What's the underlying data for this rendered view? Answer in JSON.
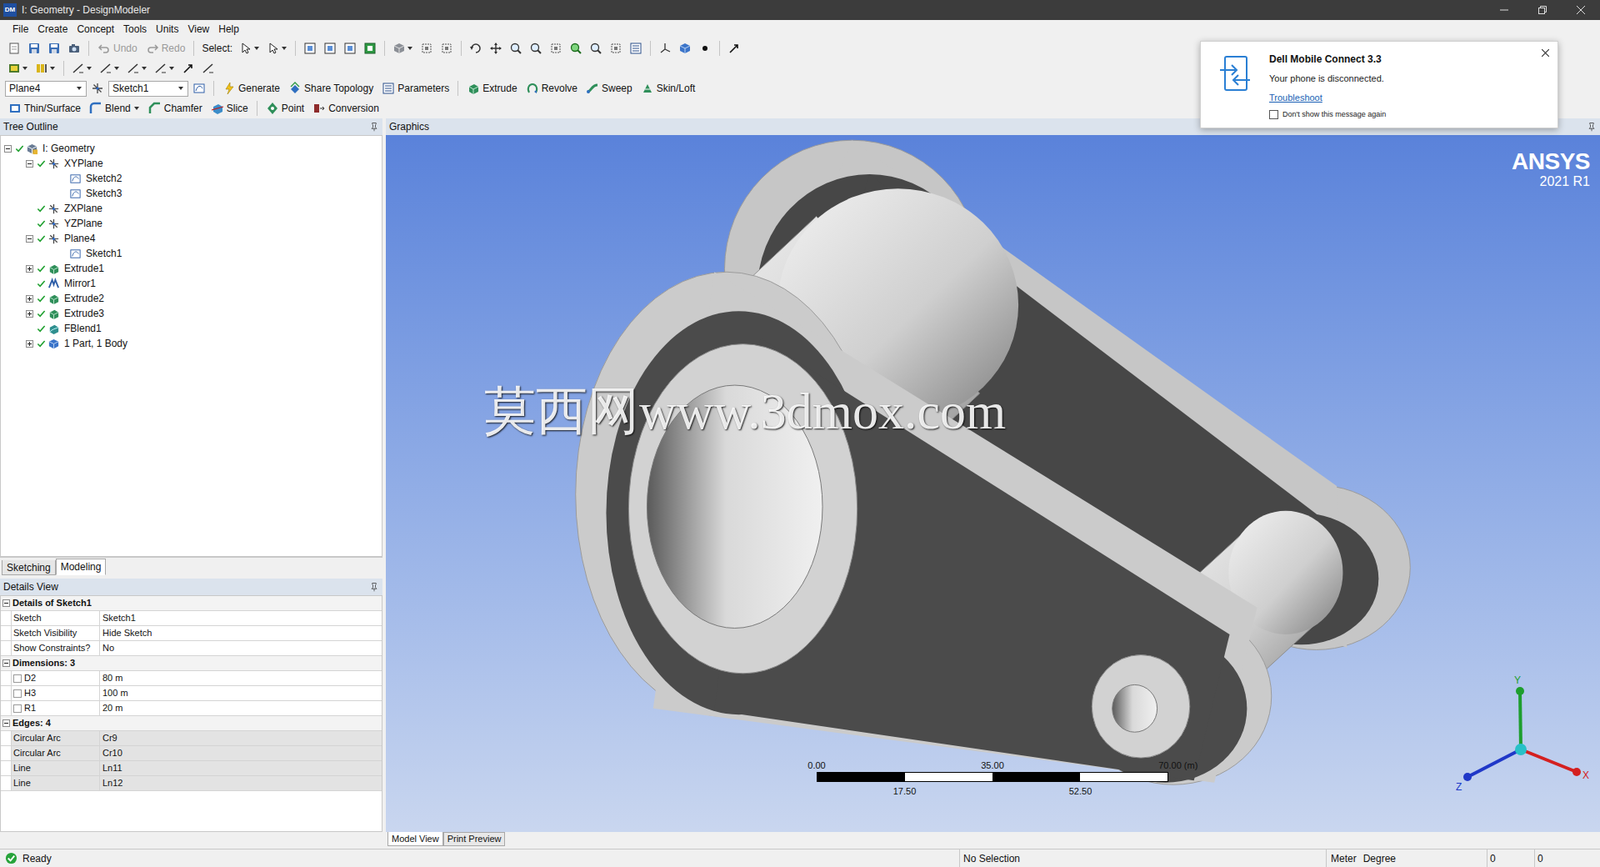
{
  "window": {
    "title": "I: Geometry - DesignModeler",
    "badge": "DM"
  },
  "menu": [
    "File",
    "Create",
    "Concept",
    "Tools",
    "Units",
    "View",
    "Help"
  ],
  "toolbar": {
    "undo": {
      "label": "Undo",
      "disabled": true
    },
    "redo": {
      "label": "Redo",
      "disabled": true
    },
    "select_label": "Select:",
    "plane": "Plane4",
    "sketch": "Sketch1",
    "features": [
      {
        "label": "Generate"
      },
      {
        "label": "Share Topology"
      },
      {
        "label": "Parameters"
      },
      {
        "label": "Extrude"
      },
      {
        "label": "Revolve"
      },
      {
        "label": "Sweep"
      },
      {
        "label": "Skin/Loft"
      }
    ],
    "tools": [
      {
        "label": "Thin/Surface",
        "dropdown": false
      },
      {
        "label": "Blend",
        "dropdown": true
      },
      {
        "label": "Chamfer",
        "dropdown": false
      },
      {
        "label": "Slice",
        "dropdown": false
      },
      {
        "label": "Point",
        "dropdown": false
      },
      {
        "label": "Conversion",
        "dropdown": false
      }
    ]
  },
  "tree": {
    "title": "Tree Outline",
    "items": [
      {
        "label": "I: Geometry",
        "depth": 0,
        "expandable": true,
        "expanded": true,
        "ok": true,
        "kind": "geometry"
      },
      {
        "label": "XYPlane",
        "depth": 1,
        "expandable": true,
        "expanded": true,
        "ok": true,
        "kind": "plane"
      },
      {
        "label": "Sketch2",
        "depth": 2,
        "expandable": false,
        "expanded": false,
        "ok": false,
        "kind": "sketch"
      },
      {
        "label": "Sketch3",
        "depth": 2,
        "expandable": false,
        "expanded": false,
        "ok": false,
        "kind": "sketch"
      },
      {
        "label": "ZXPlane",
        "depth": 1,
        "expandable": false,
        "expanded": false,
        "ok": true,
        "kind": "plane"
      },
      {
        "label": "YZPlane",
        "depth": 1,
        "expandable": false,
        "expanded": false,
        "ok": true,
        "kind": "plane"
      },
      {
        "label": "Plane4",
        "depth": 1,
        "expandable": true,
        "expanded": true,
        "ok": true,
        "kind": "plane"
      },
      {
        "label": "Sketch1",
        "depth": 2,
        "expandable": false,
        "expanded": false,
        "ok": false,
        "kind": "sketch"
      },
      {
        "label": "Extrude1",
        "depth": 1,
        "expandable": true,
        "expanded": false,
        "ok": true,
        "kind": "extrude"
      },
      {
        "label": "Mirror1",
        "depth": 1,
        "expandable": false,
        "expanded": false,
        "ok": true,
        "kind": "mirror"
      },
      {
        "label": "Extrude2",
        "depth": 1,
        "expandable": true,
        "expanded": false,
        "ok": true,
        "kind": "extrude"
      },
      {
        "label": "Extrude3",
        "depth": 1,
        "expandable": true,
        "expanded": false,
        "ok": true,
        "kind": "extrude"
      },
      {
        "label": "FBlend1",
        "depth": 1,
        "expandable": false,
        "expanded": false,
        "ok": true,
        "kind": "blend"
      },
      {
        "label": "1 Part, 1 Body",
        "depth": 1,
        "expandable": true,
        "expanded": false,
        "ok": true,
        "kind": "part"
      }
    ]
  },
  "panel_tabs": [
    {
      "label": "Sketching",
      "selected": false
    },
    {
      "label": "Modeling",
      "selected": true
    }
  ],
  "details": {
    "title": "Details View",
    "groups": [
      {
        "label": "Details of Sketch1",
        "expanded": true,
        "rows": [
          {
            "label": "Sketch",
            "value": "Sketch1",
            "kind": "plain",
            "greyed": false
          },
          {
            "label": "Sketch Visibility",
            "value": "Hide Sketch",
            "kind": "plain",
            "greyed": false
          },
          {
            "label": "Show Constraints?",
            "value": "No",
            "kind": "plain",
            "greyed": false
          }
        ]
      },
      {
        "label": "Dimensions: 3",
        "expanded": true,
        "rows": [
          {
            "label": "D2",
            "value": "80 m",
            "kind": "checkbox",
            "checked": false,
            "greyed": false
          },
          {
            "label": "H3",
            "value": "100 m",
            "kind": "checkbox",
            "checked": false,
            "greyed": false
          },
          {
            "label": "R1",
            "value": "20 m",
            "kind": "checkbox",
            "checked": false,
            "greyed": false
          }
        ]
      },
      {
        "label": "Edges: 4",
        "expanded": true,
        "rows": [
          {
            "label": "Circular Arc",
            "value": "Cr9",
            "kind": "plain",
            "greyed": true
          },
          {
            "label": "Circular Arc",
            "value": "Cr10",
            "kind": "plain",
            "greyed": true
          },
          {
            "label": "Line",
            "value": "Ln11",
            "kind": "plain",
            "greyed": true
          },
          {
            "label": "Line",
            "value": "Ln12",
            "kind": "plain",
            "greyed": true
          }
        ]
      }
    ]
  },
  "graphics": {
    "title": "Graphics",
    "logo": {
      "name": "ANSYS",
      "version": "2021 R1"
    },
    "watermark": "莫西网www.3dmox.com",
    "scale": {
      "top": [
        "0.00",
        "35.00",
        "70.00 (m)"
      ],
      "bottom": [
        "17.50",
        "52.50"
      ]
    },
    "axes": [
      {
        "label": "Y",
        "color": "#1e9e2e"
      },
      {
        "label": "X",
        "color": "#d42020"
      },
      {
        "label": "Z",
        "color": "#2038c8"
      }
    ]
  },
  "view_tabs": [
    {
      "label": "Model View",
      "selected": true
    },
    {
      "label": "Print Preview",
      "selected": false
    }
  ],
  "status": {
    "message": "Ready",
    "ok": true,
    "selection": "No Selection",
    "length_unit": "Meter",
    "angle_unit": "Degree",
    "fields": [
      "0",
      "0"
    ]
  },
  "notification": {
    "title": "Dell Mobile Connect 3.3",
    "message": "Your phone is disconnected.",
    "link": "Troubleshoot",
    "checkbox": {
      "label": "Don't show this message again",
      "checked": false
    }
  }
}
